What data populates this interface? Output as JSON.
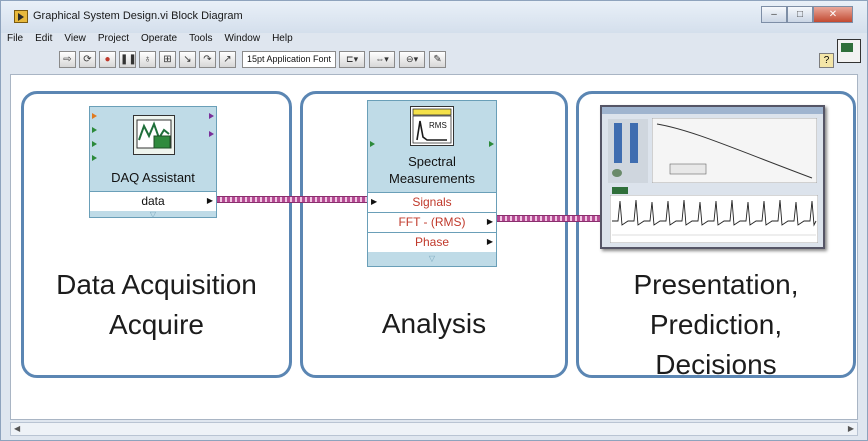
{
  "window": {
    "title": "Graphical System Design.vi Block Diagram",
    "controls": [
      "–",
      "□",
      "✕"
    ]
  },
  "menu": [
    "File",
    "Edit",
    "View",
    "Project",
    "Operate",
    "Tools",
    "Window",
    "Help"
  ],
  "toolbar": {
    "font": "15pt Application Font"
  },
  "panels": {
    "acquire": {
      "line1": "Data Acquisition",
      "line2": "Acquire"
    },
    "analysis": {
      "line1": "Analysis"
    },
    "presentation": {
      "line1": "Presentation,",
      "line2": "Prediction,",
      "line3": "Decisions"
    }
  },
  "daq": {
    "title": "DAQ Assistant",
    "terminal": "data"
  },
  "spectral": {
    "title1": "Spectral",
    "title2": "Measurements",
    "icon_label": "RMS",
    "terminals": [
      "Signals",
      "FFT - (RMS)",
      "Phase"
    ]
  },
  "colors": {
    "panel_border": "#5b86b3",
    "node_fill": "#bfdbe7",
    "wire": "#b54a93",
    "terminal_text": "#c0392b"
  }
}
